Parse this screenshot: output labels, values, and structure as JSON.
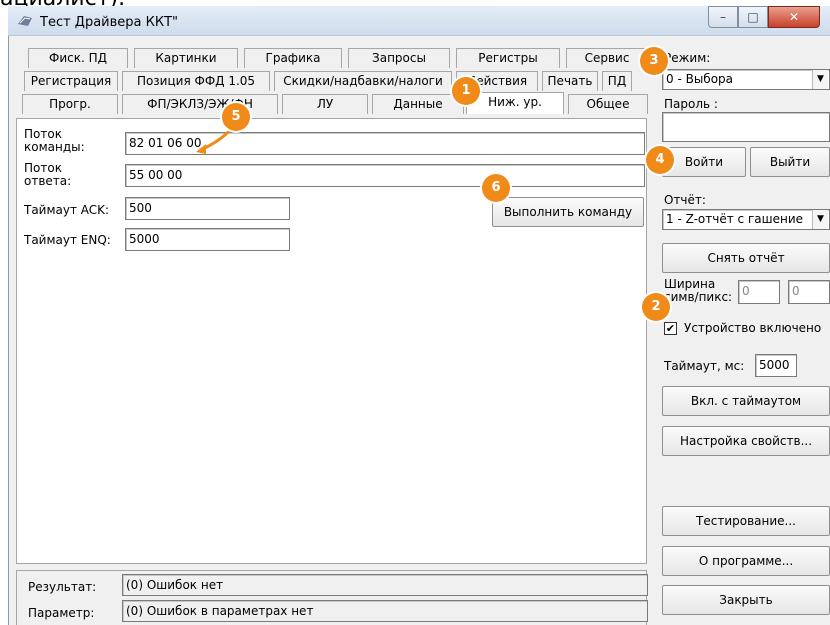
{
  "top_cut_text": "ациалист).",
  "window": {
    "title": "Тест Драйвера ККТ\"",
    "buttons": {
      "minimize": "–",
      "maximize": "□",
      "close": "✕"
    }
  },
  "tabs": {
    "row1": [
      "Фиск. ПД",
      "Картинки",
      "Графика",
      "Запросы",
      "Регистры",
      "Сервис"
    ],
    "row2": [
      "Регистрация",
      "Позиция ФФД 1.05",
      "Скидки/надбавки/налоги",
      "Действия",
      "Печать",
      "ПД"
    ],
    "row3": [
      "Прогр.",
      "ФП/ЭКЛЗ/ЭЖ/ФН",
      "ЛУ",
      "Данные",
      "Ниж. ур.",
      "Общее"
    ],
    "active": "Ниж. ур."
  },
  "main": {
    "cmd_stream_label": "Поток\nкоманды:",
    "cmd_stream_value": "82 01 06 00",
    "resp_stream_label": "Поток\nответа:",
    "resp_stream_value": "55 00 00",
    "ack_label": "Таймаут ACK:",
    "ack_value": "500",
    "enq_label": "Таймаут ENQ:",
    "enq_value": "5000",
    "execute_button": "Выполнить команду"
  },
  "bottom": {
    "result_label": "Результат:",
    "result_value": "(0) Ошибок нет",
    "param_label": "Параметр:",
    "param_value": "(0) Ошибок в параметрах нет"
  },
  "side": {
    "mode_label": "Режим:",
    "mode_value": "0 - Выбора",
    "password_label": "Пароль :",
    "password_value": "",
    "login_button": "Войти",
    "logout_button": "Выйти",
    "report_label": "Отчёт:",
    "report_value": "1 - Z-отчёт с гашение",
    "take_report_button": "Снять отчёт",
    "width_label": "Ширина\nсимв/пикс:",
    "width_value1": "0",
    "width_value2": "0",
    "device_enabled_label": "Устройство включено",
    "timeout_label": "Таймаут, мс:",
    "timeout_value": "5000",
    "enable_timeout_button": "Вкл. с таймаутом",
    "settings_button": "Настройка свойств...",
    "testing_button": "Тестирование...",
    "about_button": "О программе...",
    "close_button": "Закрыть"
  },
  "badges": [
    "1",
    "2",
    "3",
    "4",
    "5",
    "6"
  ],
  "colors": {
    "badge": "#f08a18",
    "arrow": "#f08a18"
  }
}
